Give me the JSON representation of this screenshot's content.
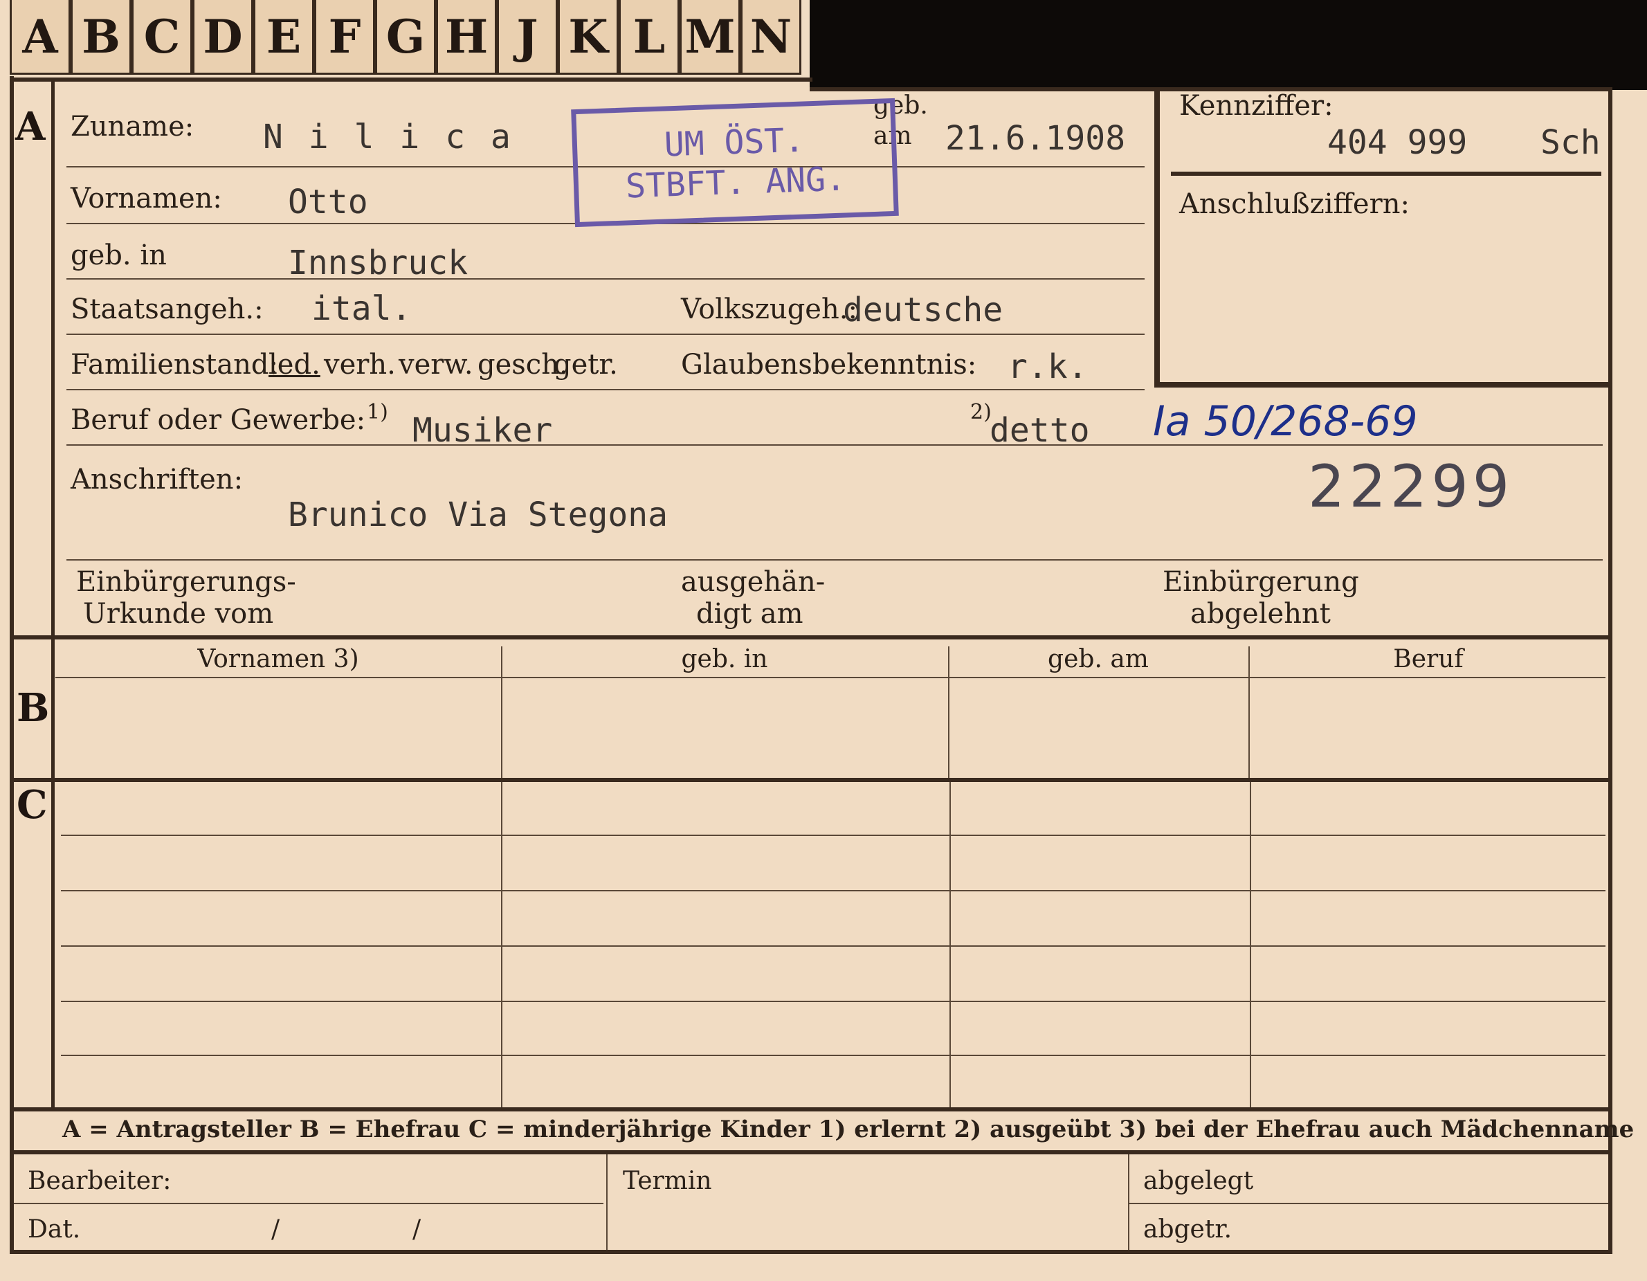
{
  "index_tabs": [
    "A",
    "B",
    "C",
    "D",
    "E",
    "F",
    "G",
    "H",
    "J",
    "K",
    "L",
    "M",
    "N"
  ],
  "section_a": {
    "marker": "A",
    "zuname_label": "Zuname:",
    "zuname_value": "N i l i c a",
    "geb_label_1": "geb.",
    "geb_label_2": "am",
    "geb_value": "21.6.1908",
    "vornamen_label": "Vornamen:",
    "vornamen_value": "Otto",
    "gebin_label": "geb. in",
    "gebin_value": "Innsbruck",
    "staat_label": "Staatsangeh.:",
    "staat_value": "ital.",
    "volk_label": "Volkszugeh.:",
    "volk_value": "deutsche",
    "familie_label": "Familienstand:",
    "familie_options": [
      "led.",
      "verh.",
      "verw.",
      "gesch.",
      "getr."
    ],
    "glauben_label": "Glaubensbekenntnis:",
    "glauben_value": "r.k.",
    "beruf_label": "Beruf oder Gewerbe:",
    "beruf_note1": "1)",
    "beruf_value": "Musiker",
    "beruf_note2": "2)",
    "beruf_value2": "detto",
    "anschrift_label": "Anschriften:",
    "anschrift_value": "Brunico Via Stegona",
    "einb_label_1": "Einbürgerungs-",
    "einb_label_2": "Urkunde vom",
    "ausg_label_1": "ausgehän-",
    "ausg_label_2": "digt am",
    "abgel_label_1": "Einbürgerung",
    "abgel_label_2": "abgelehnt"
  },
  "kennziffer": {
    "label": "Kennziffer:",
    "value": "404 999",
    "suffix": "Sch",
    "anschluss_label": "Anschlußziffern:"
  },
  "stamp": {
    "line1": "UM ÖST.",
    "line2": "STBFT. ANG."
  },
  "handwritten": "Ia 50/268-69",
  "number_stamp": "22299",
  "section_b": {
    "marker": "B",
    "columns": [
      "Vornamen 3)",
      "geb. in",
      "geb. am",
      "Beruf"
    ]
  },
  "section_c": {
    "marker": "C"
  },
  "legend": "A = Antragsteller   B = Ehefrau   C = minderjährige Kinder   1) erlernt   2) ausgeübt   3) bei der Ehefrau auch Mädchenname",
  "footer": {
    "bearbeiter": "Bearbeiter:",
    "dat": "Dat.",
    "slash1": "/",
    "slash2": "/",
    "termin": "Termin",
    "abgelegt": "abgelegt",
    "abgetr": "abgetr."
  }
}
